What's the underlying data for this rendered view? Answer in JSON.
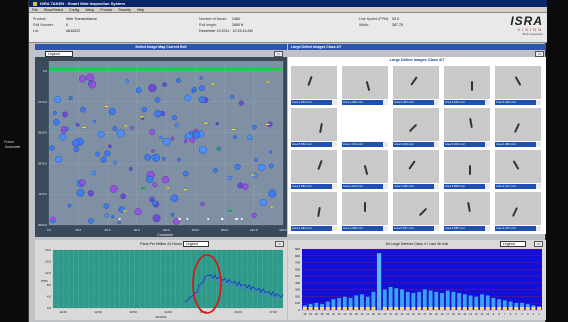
{
  "window": {
    "title": "ISRA TAKEN · Smart Web Inspection System",
    "menus": [
      "File",
      "Show/Select",
      "Config",
      "Setup",
      "Product",
      "Security",
      "Help"
    ]
  },
  "sidebar": {
    "label": "Frame"
  },
  "info": {
    "left": [
      {
        "label": "Product:",
        "value": "Web Transmittance"
      },
      {
        "label": "Roll Number:",
        "value": "0"
      },
      {
        "label": "Lot:",
        "value": "A618222"
      }
    ],
    "mid": [
      {
        "label": "Number of Areas:",
        "value": "2460"
      },
      {
        "label": "Roll length:",
        "value": "2890 ft"
      },
      {
        "label": "",
        "value": "December 19,2011 · 10:23:14 AM"
      }
    ],
    "right": [
      {
        "label": "Line Speed (FPM):",
        "value": "94.0"
      },
      {
        "label": "Width:",
        "value": "387.75"
      }
    ],
    "logo": {
      "big": "ISRA",
      "vision": "VISION",
      "sub": "Web Inspection"
    }
  },
  "map_panel": {
    "title": "Defect Image Map Current Roll",
    "legend_label": "Legend",
    "x_label": "Crossweb",
    "y_label": "Downweb",
    "x_ticks": [
      "0.0",
      "30.0",
      "60.0",
      "90.0",
      "120.0",
      "150.0",
      "180.0",
      "210.0",
      "240.0"
    ],
    "y_ticks": [
      "0.0",
      "2770.0",
      "5550.0",
      "8330.0",
      "1110.0",
      "2000.0"
    ]
  },
  "defect_panel": {
    "title": "Large Defect Images Class 4/7",
    "grid_title": "Large Defect Images Class 4/7",
    "captions": [
      "Area 1,464 mm²",
      "Area 1,480 mm²",
      "Area 5,333 mm²",
      "Area 4,916 mm²",
      "Area 5,546 mm²",
      "Area 5,681 mm²",
      "Area 1,136 mm²",
      "Area 6,323 mm²",
      "Area 6,204 mm²",
      "Area 4,484 mm²",
      "Area 4,283 mm²",
      "Area 1,164 mm²",
      "Area 3,260 mm²",
      "Area 5,808 mm²",
      "Area 3,317 mm²",
      "Area 3,494 mm²",
      "Area 4,308 mm²",
      "Area 5,257 mm²",
      "Area 4,689 mm²",
      "Area 3,476 mm²"
    ]
  },
  "trend_panel": {
    "title": "Parts Per Million 24 Hours",
    "legend_label": "Legend",
    "y_label": "PPM",
    "y_ticks": [
      "20.0",
      "16.0",
      "12.0",
      "8.0",
      "4.0",
      "0.0"
    ],
    "x_ticks": [
      "11:00",
      "12:00",
      "13:00",
      "14:00",
      "15:00",
      "16:00",
      "17:00"
    ],
    "x_label": "12/19/11"
  },
  "histogram_panel": {
    "title": "All Large Defects Class 4 / Last 48 rolls",
    "legend_label": "Legend",
    "y_ticks": [
      "900",
      "800",
      "700",
      "600",
      "500",
      "400",
      "300",
      "200",
      "100",
      "0"
    ],
    "x_ticks": [
      "45",
      "16",
      "39",
      "35",
      "38",
      "31",
      "15",
      "13",
      "32",
      "28",
      "16",
      "14",
      "36",
      "40",
      "26",
      "21",
      "29",
      "33",
      "24",
      "23",
      "22",
      "21",
      "20",
      "19",
      "18",
      "17",
      "16",
      "15",
      "14",
      "13",
      "12",
      "11",
      "10",
      "9",
      "8",
      "7",
      "6",
      "5",
      "4",
      "3",
      "2",
      "1"
    ]
  }
}
